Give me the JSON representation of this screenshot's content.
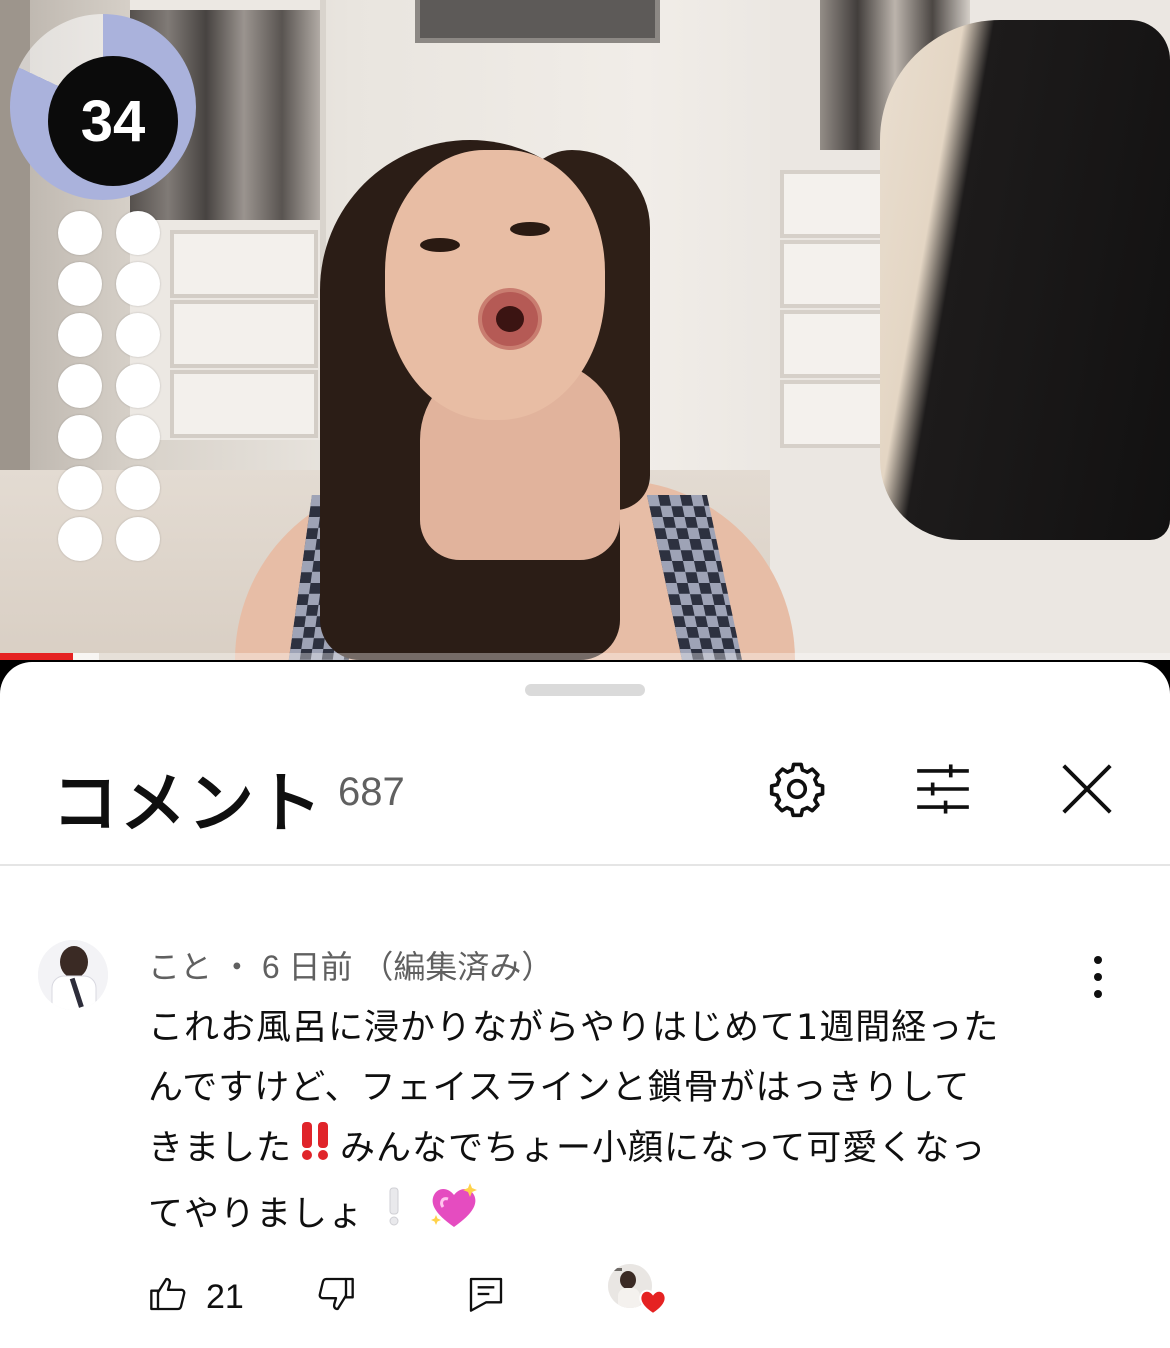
{
  "video": {
    "progress_fraction": 0.062,
    "buffer_fraction": 0.085,
    "timer_value": "34",
    "timer_ring_fraction": 0.82,
    "dot_count": 14
  },
  "comments_panel": {
    "title": "コメント",
    "count": "687",
    "settings_icon": "gear-icon",
    "filter_icon": "sliders-icon",
    "close_icon": "close-icon"
  },
  "comment": {
    "author": "こと",
    "separator": "・",
    "time": "6 日前",
    "edited": "（編集済み）",
    "lines": [
      "これお風呂に浸かりながらやりはじめて1週間経った",
      "んですけど、フェイスラインと鎖骨がはっきりして"
    ],
    "line3_before": "きました",
    "line3_after": "みんなでちょー小顔になって可愛くなっ",
    "line4": "てやりましょ",
    "emoji_1": "double-exclamation-emoji",
    "emoji_2": "white-exclamation-emoji",
    "emoji_3": "sparkling-heart-emoji",
    "likes": "21",
    "like_icon": "thumbs-up-icon",
    "dislike_icon": "thumbs-down-icon",
    "reply_icon": "reply-icon",
    "creator_heart_icon": "heart-icon"
  },
  "colors": {
    "accent_red": "#e52222",
    "timer_ring": "#aab2dc",
    "text_primary": "#0f0f0f",
    "text_secondary": "#606060"
  }
}
